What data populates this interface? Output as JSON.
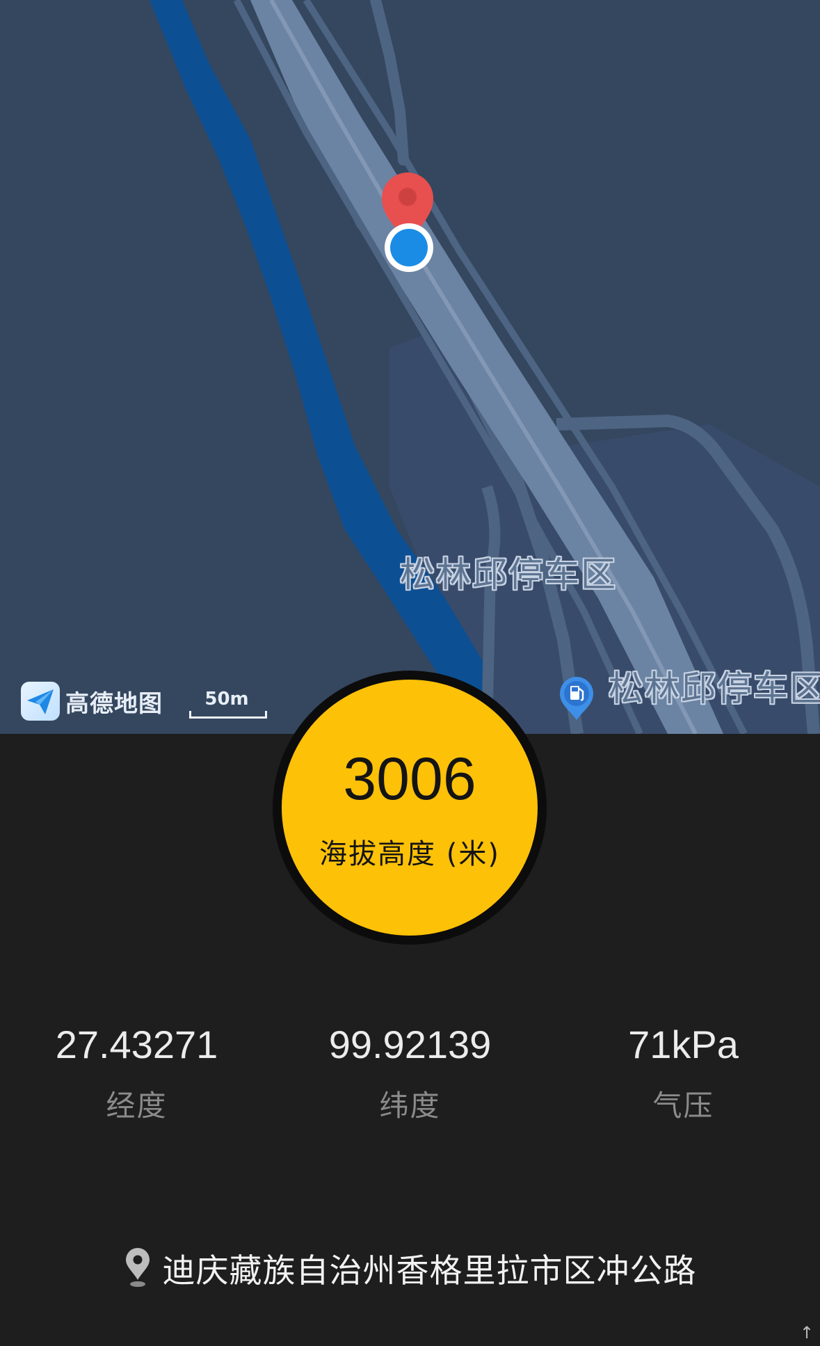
{
  "map": {
    "poi_labels": [
      "松林邱停车区",
      "松林邱停车区"
    ],
    "logo_text": "高德地图",
    "scale_label": "50m",
    "colors": {
      "background": "#34475f",
      "river": "#0d4f93",
      "road": "#6c84a3",
      "road_edge": "#4d6482",
      "pin": "#e84f4f",
      "location_dot": "#1a8ce6"
    },
    "icons": [
      "location-pin-icon",
      "current-location-icon",
      "fuel-station-icon",
      "amap-logo-icon"
    ]
  },
  "altitude": {
    "value": "3006",
    "label": "海拔高度 (米)",
    "color": "#fdc108"
  },
  "stats": [
    {
      "value": "27.43271",
      "label": "经度"
    },
    {
      "value": "99.92139",
      "label": "纬度"
    },
    {
      "value": "71kPa",
      "label": "气压"
    }
  ],
  "address": {
    "text": "迪庆藏族自治州香格里拉市区冲公路",
    "icon": "location-marker-icon"
  }
}
